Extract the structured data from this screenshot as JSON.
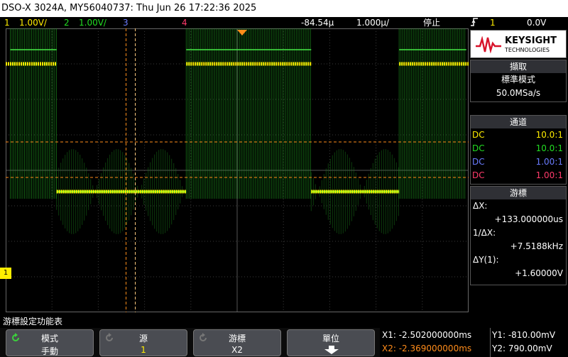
{
  "title": "DSO-X 3024A, MY56040737: Thu Jun 26 17:22:36 2025",
  "channels": [
    {
      "num": "1",
      "scale": "1.00V/",
      "color": "#ffee00"
    },
    {
      "num": "2",
      "scale": "1.00V/",
      "color": "#22dd22"
    },
    {
      "num": "3",
      "scale": "",
      "color": "#6a7cff"
    },
    {
      "num": "4",
      "scale": "",
      "color": "#ff3b6b"
    }
  ],
  "timebase": {
    "delay": "-84.54µ",
    "scale": "1.000µ/"
  },
  "run_state": "停止",
  "trigger": {
    "icon": "rising-edge-icon",
    "channel": "1",
    "level": "0.0V"
  },
  "brand": {
    "name": "KEYSIGHT",
    "sub": "TECHNOLOGIES"
  },
  "acquisition": {
    "header": "擷取",
    "mode": "標準模式",
    "rate": "50.0MSa/s"
  },
  "channel_panel": {
    "header": "通道",
    "rows": [
      {
        "coupling": "DC",
        "probe": "10.0:1",
        "color": "#ffee00"
      },
      {
        "coupling": "DC",
        "probe": "10.0:1",
        "color": "#22dd22"
      },
      {
        "coupling": "DC",
        "probe": "1.00:1",
        "color": "#6a7cff"
      },
      {
        "coupling": "DC",
        "probe": "1.00:1",
        "color": "#ff3b6b"
      }
    ]
  },
  "cursors_panel": {
    "header": "游標",
    "dx_label": "ΔX:",
    "dx_value": "+133.000000us",
    "inv_label": "1/ΔX:",
    "inv_value": "+7.5188kHz",
    "dy_label": "ΔY(1):",
    "dy_value": "+1.60000V"
  },
  "softkey_menu_title": "游標設定功能表",
  "softkeys": [
    {
      "label": "模式",
      "value": "手動"
    },
    {
      "label": "源",
      "value": "1"
    },
    {
      "label": "游標",
      "value": "X2"
    },
    {
      "label": "單位",
      "value": ""
    }
  ],
  "readouts": {
    "x1": "X1: -2.502000000ms",
    "x2": "X2: -2.369000000ms",
    "y1": "Y1: -810.00mV",
    "y2": "Y2: 790.00mV"
  },
  "ground_marker": "1",
  "trace_levels": {
    "ch1_high": 2.8,
    "ch1_low": -0.8,
    "ch2_high": 3.2,
    "ch2_low": -0.8,
    "ch1_high_segments_div": [
      [
        0,
        1.1
      ],
      [
        3.9,
        6.6
      ],
      [
        8.5,
        10
      ]
    ],
    "ch1_low_segments_div": [
      [
        1.1,
        3.9
      ],
      [
        6.6,
        8.5
      ]
    ]
  }
}
